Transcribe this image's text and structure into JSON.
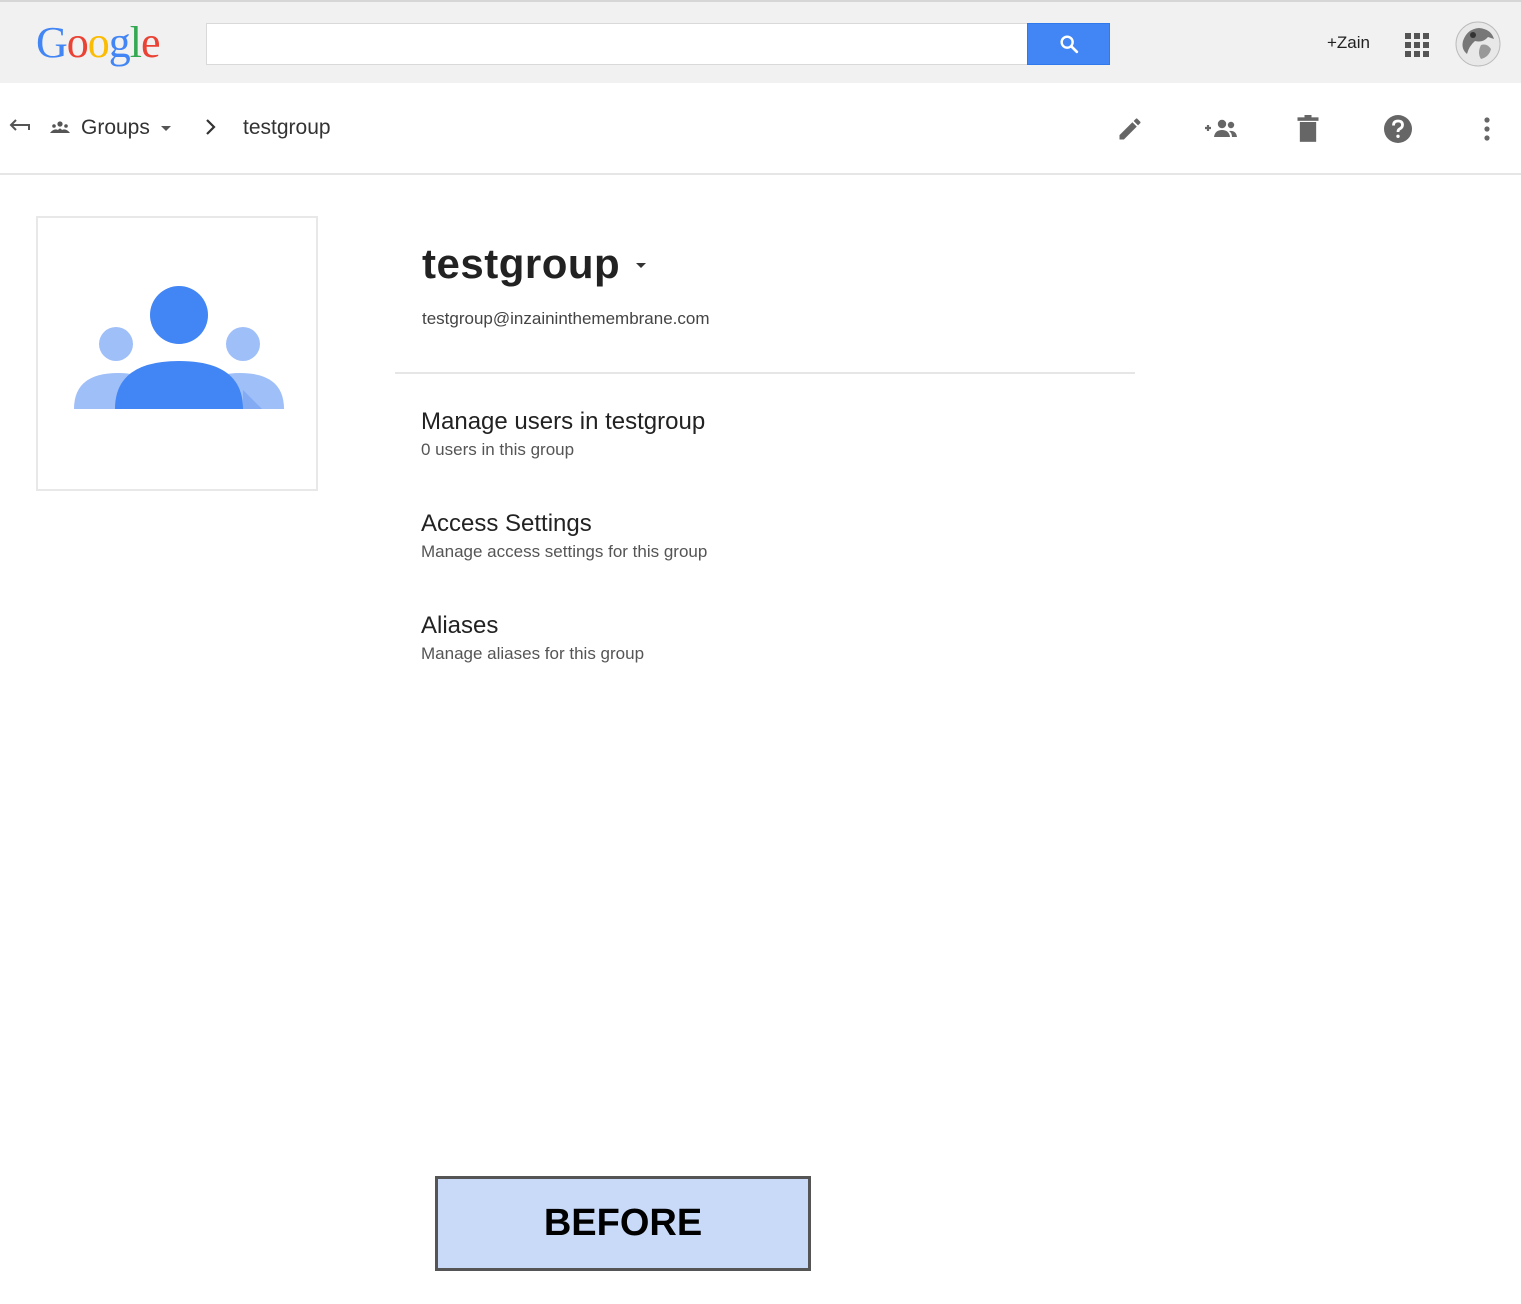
{
  "header": {
    "logo_letters": [
      "G",
      "o",
      "o",
      "g",
      "l",
      "e"
    ],
    "logo_colors": [
      "#4285f4",
      "#ea4335",
      "#fbbc05",
      "#4285f4",
      "#34a853",
      "#ea4335"
    ],
    "search_value": "",
    "search_icon": "search-icon",
    "user_link": "+Zain",
    "apps_icon": "apps-grid-icon",
    "accent": "#4285f4"
  },
  "breadcrumb": {
    "groups_label": "Groups",
    "current": "testgroup"
  },
  "toolbar_icons": [
    "edit-icon",
    "add-member-icon",
    "delete-icon",
    "help-icon",
    "more-vert-icon"
  ],
  "group": {
    "name": "testgroup",
    "email": "testgroup@inzaininthemembrane.com",
    "sections": [
      {
        "title": "Manage users in testgroup",
        "subtitle": "0 users in this group"
      },
      {
        "title": "Access Settings",
        "subtitle": "Manage access settings for this group"
      },
      {
        "title": "Aliases",
        "subtitle": "Manage aliases for this group"
      }
    ]
  },
  "overlay": {
    "label": "BEFORE",
    "color": "#c9daf8"
  }
}
